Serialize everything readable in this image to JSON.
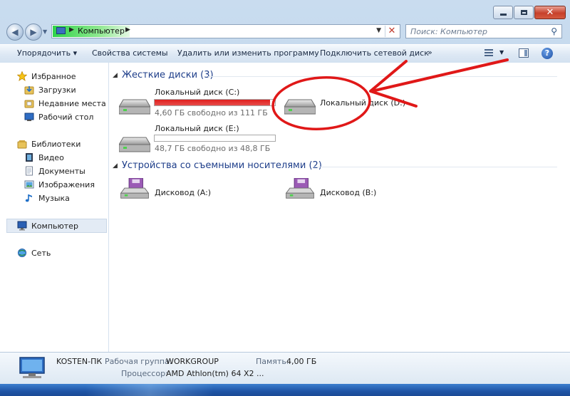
{
  "window": {
    "caption_buttons": [
      "minimize-icon",
      "maximize-icon",
      "close-icon"
    ]
  },
  "address_bar": {
    "path": "Компьютер",
    "search_placeholder": "Поиск: Компьютер"
  },
  "toolbar": {
    "organize": "Упорядочить ▾",
    "system_properties": "Свойства системы",
    "uninstall": "Удалить или изменить программу",
    "map_drive": "Подключить сетевой диск",
    "more": "»"
  },
  "sidebar": {
    "favorites": {
      "label": "Избранное",
      "items": [
        "Загрузки",
        "Недавние места",
        "Рабочий стол"
      ]
    },
    "libraries": {
      "label": "Библиотеки",
      "items": [
        "Видео",
        "Документы",
        "Изображения",
        "Музыка"
      ]
    },
    "computer": "Компьютер",
    "network": "Сеть"
  },
  "hard_drives": {
    "title": "Жесткие диски (3)",
    "drives": [
      {
        "name": "Локальный диск (C:)",
        "free": "4,60 ГБ свободно из 111 ГБ",
        "used_fraction": 0.96,
        "bar_color": "#e0201e"
      },
      {
        "name": "Локальный диск (E:)",
        "free": "48,7 ГБ свободно из 48,8 ГБ",
        "used_fraction": 0.002,
        "bar_color": "#2b8fe0"
      },
      {
        "name": "Локальный диск (D:)"
      }
    ]
  },
  "removable": {
    "title": "Устройства со съемными носителями (2)",
    "devices": [
      {
        "name": "Дисковод (A:)"
      },
      {
        "name": "Дисковод (B:)"
      }
    ]
  },
  "details": {
    "computer_name": "KOSTEN-ПК",
    "workgroup_label": "Рабочая группа:",
    "workgroup": "WORKGROUP",
    "memory_label": "Память:",
    "memory": "4,00 ГБ",
    "cpu_label": "Процессор:",
    "cpu": "AMD Athlon(tm) 64 X2 ..."
  },
  "colors": {
    "annotation_red": "#e01818",
    "group_title_blue": "#1e3e8a"
  }
}
